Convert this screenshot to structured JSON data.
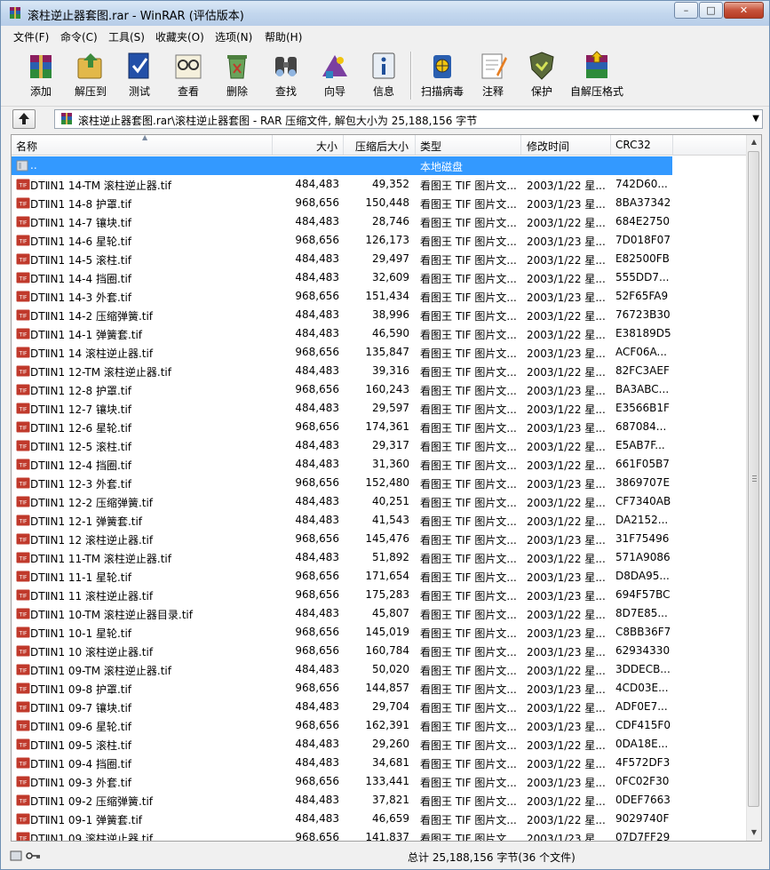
{
  "window": {
    "title": "滚柱逆止器套图.rar - WinRAR (评估版本)",
    "minimize": "–",
    "maximize": "□",
    "close": "✕"
  },
  "menu": [
    "文件(F)",
    "命令(C)",
    "工具(S)",
    "收藏夹(O)",
    "选项(N)",
    "帮助(H)"
  ],
  "toolbar": [
    {
      "label": "添加",
      "icon": "add-archive-icon"
    },
    {
      "label": "解压到",
      "icon": "extract-to-icon"
    },
    {
      "label": "测试",
      "icon": "test-icon"
    },
    {
      "label": "查看",
      "icon": "view-icon"
    },
    {
      "label": "删除",
      "icon": "delete-icon"
    },
    {
      "label": "查找",
      "icon": "find-icon"
    },
    {
      "label": "向导",
      "icon": "wizard-icon"
    },
    {
      "label": "信息",
      "icon": "info-icon"
    },
    {
      "label": "扫描病毒",
      "icon": "virus-scan-icon"
    },
    {
      "label": "注释",
      "icon": "comment-icon"
    },
    {
      "label": "保护",
      "icon": "protect-icon"
    },
    {
      "label": "自解压格式",
      "icon": "sfx-icon"
    }
  ],
  "address": {
    "path": "滚柱逆止器套图.rar\\滚柱逆止器套图 - RAR 压缩文件, 解包大小为 25,188,156 字节"
  },
  "columns": [
    "名称",
    "大小",
    "压缩后大小",
    "类型",
    "修改时间",
    "CRC32"
  ],
  "parent_row": {
    "name": "..",
    "type": "本地磁盘"
  },
  "files": [
    [
      "DTⅡN1 14-TM 滚柱逆止器.tif",
      "484,483",
      "49,352",
      "看图王 TIF 图片文...",
      "2003/1/22 星...",
      "742D60..."
    ],
    [
      "DTⅡN1 14-8 护罩.tif",
      "968,656",
      "150,448",
      "看图王 TIF 图片文...",
      "2003/1/23 星...",
      "8BA37342"
    ],
    [
      "DTⅡN1 14-7 镶块.tif",
      "484,483",
      "28,746",
      "看图王 TIF 图片文...",
      "2003/1/22 星...",
      "684E2750"
    ],
    [
      "DTⅡN1 14-6 星轮.tif",
      "968,656",
      "126,173",
      "看图王 TIF 图片文...",
      "2003/1/23 星...",
      "7D018F07"
    ],
    [
      "DTⅡN1 14-5 滚柱.tif",
      "484,483",
      "29,497",
      "看图王 TIF 图片文...",
      "2003/1/22 星...",
      "E82500FB"
    ],
    [
      "DTⅡN1 14-4 挡圈.tif",
      "484,483",
      "32,609",
      "看图王 TIF 图片文...",
      "2003/1/22 星...",
      "555DD7..."
    ],
    [
      "DTⅡN1 14-3 外套.tif",
      "968,656",
      "151,434",
      "看图王 TIF 图片文...",
      "2003/1/23 星...",
      "52F65FA9"
    ],
    [
      "DTⅡN1 14-2 压缩弹簧.tif",
      "484,483",
      "38,996",
      "看图王 TIF 图片文...",
      "2003/1/22 星...",
      "76723B30"
    ],
    [
      "DTⅡN1 14-1 弹簧套.tif",
      "484,483",
      "46,590",
      "看图王 TIF 图片文...",
      "2003/1/22 星...",
      "E38189D5"
    ],
    [
      "DTⅡN1 14 滚柱逆止器.tif",
      "968,656",
      "135,847",
      "看图王 TIF 图片文...",
      "2003/1/23 星...",
      "ACF06A..."
    ],
    [
      "DTⅡN1 12-TM 滚柱逆止器.tif",
      "484,483",
      "39,316",
      "看图王 TIF 图片文...",
      "2003/1/22 星...",
      "82FC3AEF"
    ],
    [
      "DTⅡN1 12-8 护罩.tif",
      "968,656",
      "160,243",
      "看图王 TIF 图片文...",
      "2003/1/23 星...",
      "BA3ABC..."
    ],
    [
      "DTⅡN1 12-7 镶块.tif",
      "484,483",
      "29,597",
      "看图王 TIF 图片文...",
      "2003/1/22 星...",
      "E3566B1F"
    ],
    [
      "DTⅡN1 12-6 星轮.tif",
      "968,656",
      "174,361",
      "看图王 TIF 图片文...",
      "2003/1/23 星...",
      "687084..."
    ],
    [
      "DTⅡN1 12-5 滚柱.tif",
      "484,483",
      "29,317",
      "看图王 TIF 图片文...",
      "2003/1/22 星...",
      "E5AB7F..."
    ],
    [
      "DTⅡN1 12-4 挡圈.tif",
      "484,483",
      "31,360",
      "看图王 TIF 图片文...",
      "2003/1/22 星...",
      "661F05B7"
    ],
    [
      "DTⅡN1 12-3 外套.tif",
      "968,656",
      "152,480",
      "看图王 TIF 图片文...",
      "2003/1/23 星...",
      "3869707E"
    ],
    [
      "DTⅡN1 12-2 压缩弹簧.tif",
      "484,483",
      "40,251",
      "看图王 TIF 图片文...",
      "2003/1/22 星...",
      "CF7340AB"
    ],
    [
      "DTⅡN1 12-1 弹簧套.tif",
      "484,483",
      "41,543",
      "看图王 TIF 图片文...",
      "2003/1/22 星...",
      "DA2152..."
    ],
    [
      "DTⅡN1 12 滚柱逆止器.tif",
      "968,656",
      "145,476",
      "看图王 TIF 图片文...",
      "2003/1/23 星...",
      "31F75496"
    ],
    [
      "DTⅡN1 11-TM 滚柱逆止器.tif",
      "484,483",
      "51,892",
      "看图王 TIF 图片文...",
      "2003/1/22 星...",
      "571A9086"
    ],
    [
      "DTⅡN1 11-1 星轮.tif",
      "968,656",
      "171,654",
      "看图王 TIF 图片文...",
      "2003/1/23 星...",
      "D8DA95..."
    ],
    [
      "DTⅡN1 11 滚柱逆止器.tif",
      "968,656",
      "175,283",
      "看图王 TIF 图片文...",
      "2003/1/23 星...",
      "694F57BC"
    ],
    [
      "DTⅡN1 10-TM 滚柱逆止器目录.tif",
      "484,483",
      "45,807",
      "看图王 TIF 图片文...",
      "2003/1/22 星...",
      "8D7E85..."
    ],
    [
      "DTⅡN1 10-1 星轮.tif",
      "968,656",
      "145,019",
      "看图王 TIF 图片文...",
      "2003/1/23 星...",
      "C8BB36F7"
    ],
    [
      "DTⅡN1 10 滚柱逆止器.tif",
      "968,656",
      "160,784",
      "看图王 TIF 图片文...",
      "2003/1/23 星...",
      "62934330"
    ],
    [
      "DTⅡN1 09-TM 滚柱逆止器.tif",
      "484,483",
      "50,020",
      "看图王 TIF 图片文...",
      "2003/1/22 星...",
      "3DDECB..."
    ],
    [
      "DTⅡN1 09-8 护罩.tif",
      "968,656",
      "144,857",
      "看图王 TIF 图片文...",
      "2003/1/23 星...",
      "4CD03E..."
    ],
    [
      "DTⅡN1 09-7 镶块.tif",
      "484,483",
      "29,704",
      "看图王 TIF 图片文...",
      "2003/1/22 星...",
      "ADF0E7..."
    ],
    [
      "DTⅡN1 09-6 星轮.tif",
      "968,656",
      "162,391",
      "看图王 TIF 图片文...",
      "2003/1/23 星...",
      "CDF415F0"
    ],
    [
      "DTⅡN1 09-5 滚柱.tif",
      "484,483",
      "29,260",
      "看图王 TIF 图片文...",
      "2003/1/22 星...",
      "0DA18E..."
    ],
    [
      "DTⅡN1 09-4 挡圈.tif",
      "484,483",
      "34,681",
      "看图王 TIF 图片文...",
      "2003/1/22 星...",
      "4F572DF3"
    ],
    [
      "DTⅡN1 09-3 外套.tif",
      "968,656",
      "133,441",
      "看图王 TIF 图片文...",
      "2003/1/23 星...",
      "0FC02F30"
    ],
    [
      "DTⅡN1 09-2 压缩弹簧.tif",
      "484,483",
      "37,821",
      "看图王 TIF 图片文...",
      "2003/1/22 星...",
      "0DEF7663"
    ],
    [
      "DTⅡN1 09-1 弹簧套.tif",
      "484,483",
      "46,659",
      "看图王 TIF 图片文...",
      "2003/1/22 星...",
      "9029740F"
    ],
    [
      "DTⅡN1 09 滚柱逆止器.tif",
      "968,656",
      "141,837",
      "看图王 TIF 图片文...",
      "2003/1/23 星...",
      "07D7FF29"
    ]
  ],
  "status": {
    "total": "总计 25,188,156 字节(36 个文件)"
  },
  "colors": {
    "selection": "#3399ff",
    "tif_icon": "#c0392b",
    "title_gradient": "#c3d7ee"
  }
}
